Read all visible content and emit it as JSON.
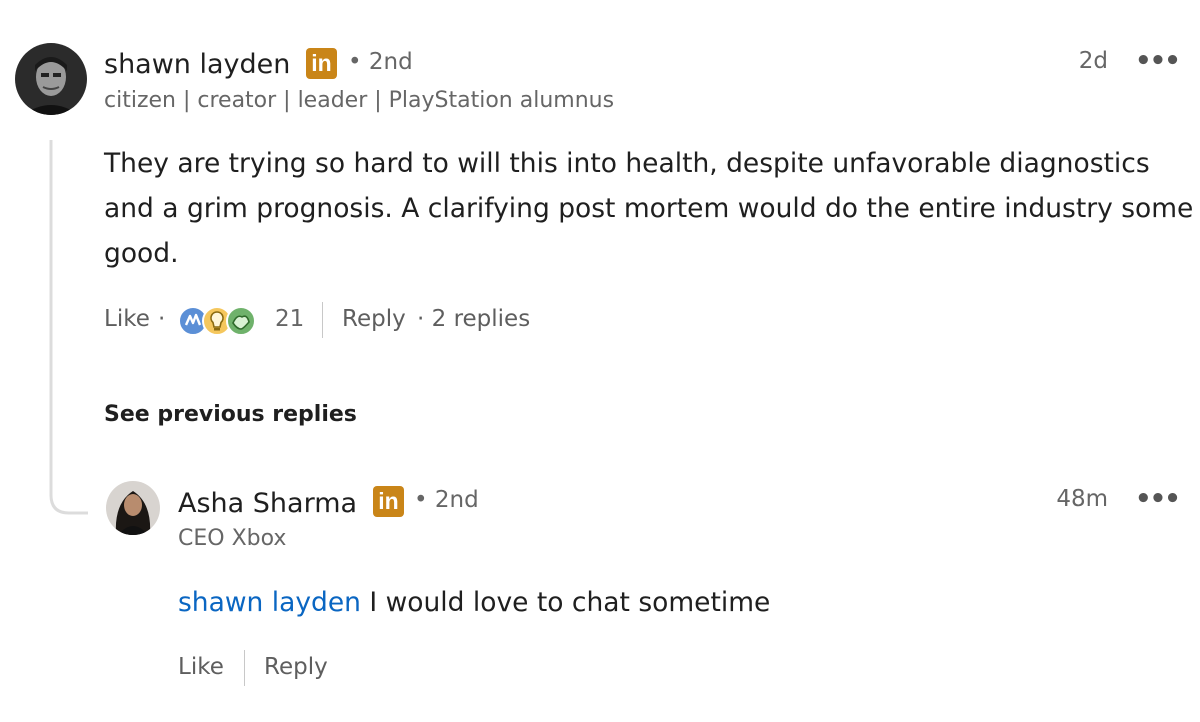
{
  "comment": {
    "author": "shawn layden",
    "degree": "• 2nd",
    "headline": "citizen | creator | leader | PlayStation alumnus",
    "time": "2d",
    "text": "They are trying so hard to will this into health, despite unfavorable diagnostics and a grim prognosis. A clarifying post mortem would do the entire industry some good.",
    "like_label": "Like",
    "dot": "·",
    "reaction_count": "21",
    "reply_label": "Reply",
    "replies_count": "· 2 replies",
    "reactions": [
      "celebrate-icon",
      "insightful-icon",
      "support-icon"
    ]
  },
  "see_previous": "See previous replies",
  "reply": {
    "author": "Asha Sharma",
    "degree": "• 2nd",
    "headline": "CEO Xbox",
    "time": "48m",
    "mention": "shawn layden",
    "text": " I would love to chat sometime",
    "like_label": "Like",
    "reply_label": "Reply"
  },
  "linkedin_badge": "in",
  "more_label": "•••",
  "colors": {
    "badge": "#c98518",
    "mention": "#0a66c2",
    "muted": "#666666",
    "thread_line": "#dcdcdc"
  }
}
